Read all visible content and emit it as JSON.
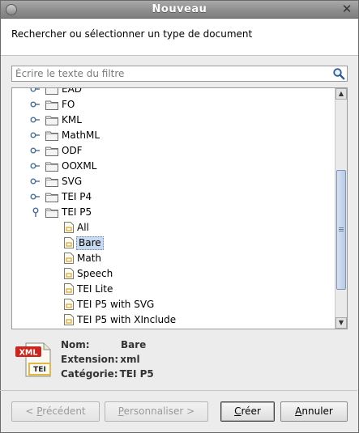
{
  "window": {
    "title": "Nouveau"
  },
  "header": {
    "text": "Rechercher ou sélectionner un type de document"
  },
  "filter": {
    "placeholder": "Écrire le texte du filtre",
    "value": ""
  },
  "tree": {
    "items": [
      {
        "label": "EAD",
        "type": "folder",
        "expanded": false
      },
      {
        "label": "FO",
        "type": "folder",
        "expanded": false
      },
      {
        "label": "KML",
        "type": "folder",
        "expanded": false
      },
      {
        "label": "MathML",
        "type": "folder",
        "expanded": false
      },
      {
        "label": "ODF",
        "type": "folder",
        "expanded": false
      },
      {
        "label": "OOXML",
        "type": "folder",
        "expanded": false
      },
      {
        "label": "SVG",
        "type": "folder",
        "expanded": false
      },
      {
        "label": "TEI P4",
        "type": "folder",
        "expanded": false
      },
      {
        "label": "TEI P5",
        "type": "folder",
        "expanded": true
      },
      {
        "label": "All",
        "type": "doc",
        "selected": false
      },
      {
        "label": "Bare",
        "type": "doc",
        "selected": true
      },
      {
        "label": "Math",
        "type": "doc",
        "selected": false
      },
      {
        "label": "Speech",
        "type": "doc",
        "selected": false
      },
      {
        "label": "TEI Lite",
        "type": "doc",
        "selected": false
      },
      {
        "label": "TEI P5 with SVG",
        "type": "doc",
        "selected": false
      },
      {
        "label": "TEI P5 with XInclude",
        "type": "doc",
        "selected": false
      }
    ],
    "scroll_position": 0.72
  },
  "details": {
    "icon_badge": "XML",
    "icon_label": "TEI",
    "name_label": "Nom:",
    "name_value": "Bare",
    "extension_label": "Extension:",
    "extension_value": "xml",
    "category_label": "Catégorie:",
    "category_value": "TEI P5"
  },
  "buttons": {
    "previous": {
      "before": "< ",
      "mnemonic": "P",
      "rest": "récédent"
    },
    "customize": {
      "mnemonic": "P",
      "rest": "ersonnaliser >"
    },
    "create": {
      "mnemonic": "C",
      "rest": "réer"
    },
    "cancel": {
      "mnemonic": "A",
      "rest": "nnuler"
    }
  },
  "colors": {
    "selection": "#c8daf0",
    "titlebar": "#8e8e8e",
    "link_blue": "#1f5fa6"
  },
  "icons": {
    "toggle_collapsed": "tree-collapsed-handle-icon",
    "toggle_expanded": "tree-expanded-handle-icon",
    "folder": "folder-icon",
    "doc": "xml-document-icon",
    "search": "search-icon"
  }
}
